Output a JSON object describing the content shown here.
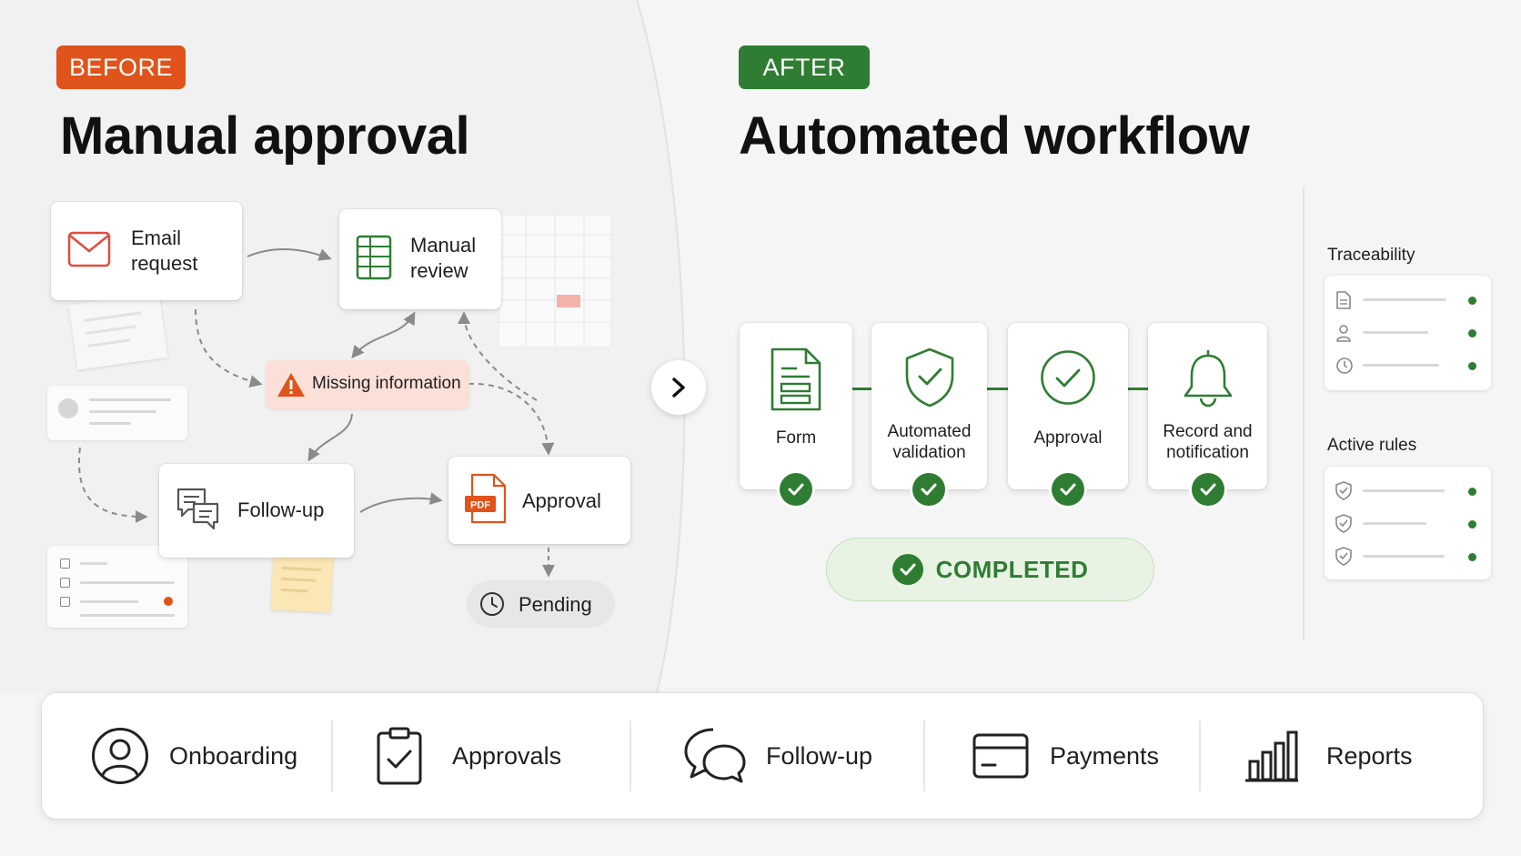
{
  "before": {
    "badge": "BEFORE",
    "title": "Manual approval",
    "badge_color": "#e0531a",
    "nodes": {
      "email_request": "Email\nrequest",
      "manual_review": "Manual\nreview",
      "missing_information": "Missing information",
      "follow_up": "Follow-up",
      "approval": "Approval",
      "pending": "Pending",
      "pdf_tag": "PDF"
    }
  },
  "after": {
    "badge": "AFTER",
    "title": "Automated workflow",
    "badge_color": "#2e7d32",
    "steps": [
      {
        "label": "Form",
        "icon": "document-icon"
      },
      {
        "label": "Automated\nvalidation",
        "icon": "shield-check-icon"
      },
      {
        "label": "Approval",
        "icon": "circle-check-icon"
      },
      {
        "label": "Record and\nnotification",
        "icon": "bell-icon"
      }
    ],
    "status": "COMPLETED",
    "side_panels": {
      "traceability": {
        "title": "Traceability",
        "rows": [
          "document-icon",
          "user-icon",
          "clock-icon"
        ]
      },
      "active_rules": {
        "title": "Active rules",
        "rows": [
          "shield-check-icon",
          "shield-check-icon",
          "shield-check-icon"
        ]
      }
    }
  },
  "bottom_bar": {
    "items": [
      {
        "label": "Onboarding",
        "icon": "user-circle-icon"
      },
      {
        "label": "Approvals",
        "icon": "clipboard-check-icon"
      },
      {
        "label": "Follow-up",
        "icon": "chat-bubbles-icon"
      },
      {
        "label": "Payments",
        "icon": "credit-card-icon"
      },
      {
        "label": "Reports",
        "icon": "bar-chart-icon"
      }
    ]
  },
  "colors": {
    "accent_orange": "#e0531a",
    "accent_green": "#2e7d32",
    "warning_bg": "#fbe0d8",
    "completed_bg": "#e8f3e4"
  }
}
